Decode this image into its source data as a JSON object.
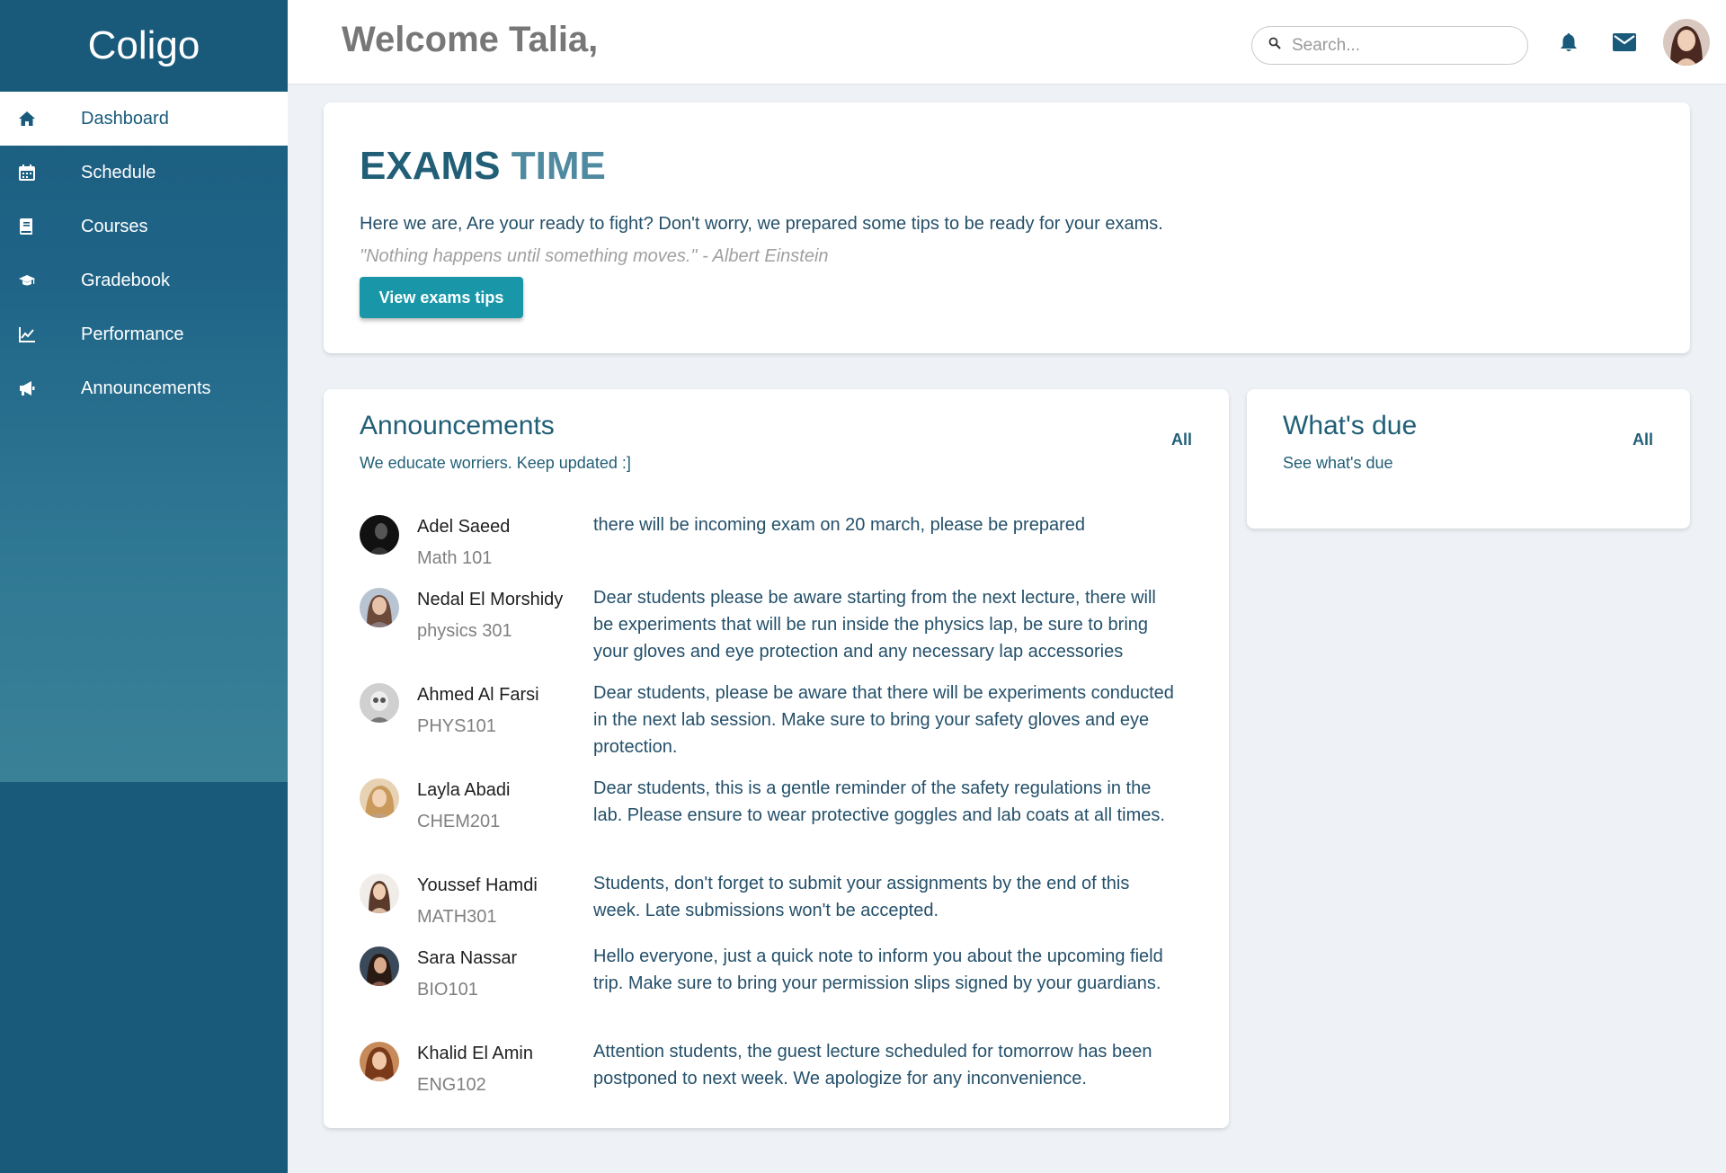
{
  "sidebar": {
    "brand": "Coligo",
    "items": [
      {
        "label": "Dashboard",
        "icon": "home-icon",
        "active": true
      },
      {
        "label": "Schedule",
        "icon": "calendar-icon",
        "active": false
      },
      {
        "label": "Courses",
        "icon": "book-icon",
        "active": false
      },
      {
        "label": "Gradebook",
        "icon": "graduation-cap-icon",
        "active": false
      },
      {
        "label": "Performance",
        "icon": "line-chart-icon",
        "active": false
      },
      {
        "label": "Announcements",
        "icon": "megaphone-icon",
        "active": false
      }
    ]
  },
  "header": {
    "welcome": "Welcome Talia,",
    "search_placeholder": "Search...",
    "icons": [
      "bell-icon",
      "mail-icon"
    ]
  },
  "exams": {
    "title_word1": "EXAMS",
    "title_word2": "TIME",
    "text": "Here we are, Are your ready to fight? Don't worry, we prepared some tips to be ready for your exams.",
    "quote": "\"Nothing happens until something moves.\" - Albert Einstein",
    "button": "View exams tips"
  },
  "announcements": {
    "title": "Announcements",
    "subtitle": "We educate worriers. Keep updated :]",
    "all_label": "All",
    "items": [
      {
        "name": "Adel Saeed",
        "course": "Math 101",
        "message": "there will be incoming exam on 20 march, please be prepared"
      },
      {
        "name": "Nedal El Morshidy",
        "course": "physics 301",
        "message": "Dear students please be aware starting from the next lecture, there will be experiments that will be run inside the physics lap, be sure to bring your gloves and eye protection and any necessary lap accessories"
      },
      {
        "name": "Ahmed Al Farsi",
        "course": "PHYS101",
        "message": "Dear students, please be aware that there will be experiments conducted in the next lab session. Make sure to bring your safety gloves and eye protection."
      },
      {
        "name": "Layla Abadi",
        "course": "CHEM201",
        "message": "Dear students, this is a gentle reminder of the safety regulations in the lab. Please ensure to wear protective goggles and lab coats at all times."
      },
      {
        "name": "Youssef Hamdi",
        "course": "MATH301",
        "message": "Students, don't forget to submit your assignments by the end of this week. Late submissions won't be accepted."
      },
      {
        "name": "Sara Nassar",
        "course": "BIO101",
        "message": "Hello everyone, just a quick note to inform you about the upcoming field trip. Make sure to bring your permission slips signed by your guardians."
      },
      {
        "name": "Khalid El Amin",
        "course": "ENG102",
        "message": "Attention students, the guest lecture scheduled for tomorrow has been postponed to next week. We apologize for any inconvenience."
      }
    ]
  },
  "whats_due": {
    "title": "What's due",
    "subtitle": "See what's due",
    "all_label": "All"
  },
  "colors": {
    "sidebar": "#195a7b",
    "accent_button": "#1997a8",
    "primary_text": "#215f77"
  }
}
